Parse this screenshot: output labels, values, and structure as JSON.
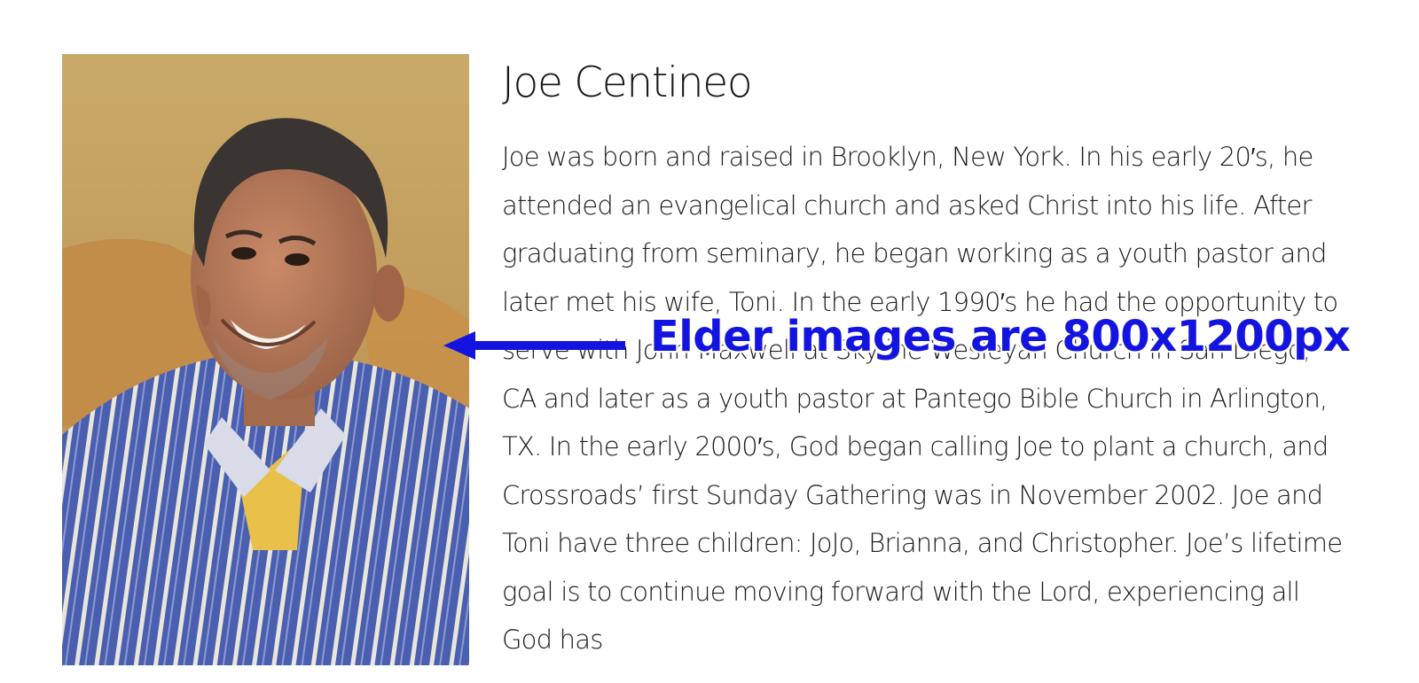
{
  "profile": {
    "name": "Joe Centineo",
    "bio": "Joe was born and raised in Brooklyn, New York. In his early 20′s, he attended an evangelical church and asked Christ into his life. After graduating from seminary, he began working as a youth pastor and later met his wife, Toni. In the early 1990′s he had the opportunity to serve with John Maxwell at Skyline Wesleyan Church in San Diego, CA and later as a youth pastor at Pantego Bible Church in Arlington, TX. In the early 2000′s, God began calling Joe to plant a church, and Crossroads’ first Sunday Gathering was in November 2002. Joe and Toni have three children: JoJo, Brianna, and Christopher. Joe’s lifetime goal is to continue moving forward with the Lord, experiencing all God has"
  },
  "annotation": {
    "text": "Elder images are 800x1200px",
    "color": "#1414e0"
  }
}
